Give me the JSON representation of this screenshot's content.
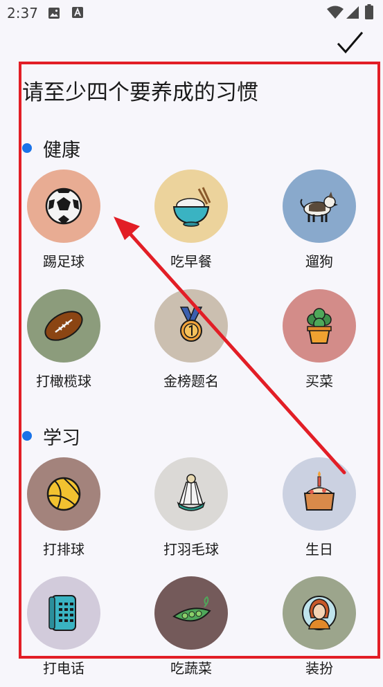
{
  "status_bar": {
    "time": "2:37",
    "icons": [
      "image-icon",
      "font-icon",
      "wifi-icon",
      "signal-icon",
      "battery-icon"
    ]
  },
  "toolbar": {
    "confirm_icon": "check-icon"
  },
  "page": {
    "title": "请至少四个要养成的习惯"
  },
  "sections": [
    {
      "label": "健康",
      "items": [
        {
          "label": "踢足球",
          "icon": "soccer-ball-icon",
          "color": "#e8ac93"
        },
        {
          "label": "吃早餐",
          "icon": "rice-bowl-icon",
          "color": "#ecd39c"
        },
        {
          "label": "遛狗",
          "icon": "dog-icon",
          "color": "#89a9cc"
        },
        {
          "label": "打橄榄球",
          "icon": "football-icon",
          "color": "#8c9c7c"
        },
        {
          "label": "金榜题名",
          "icon": "medal-icon",
          "color": "#cbbfb0"
        },
        {
          "label": "买菜",
          "icon": "potted-plant-icon",
          "color": "#d38c89"
        }
      ]
    },
    {
      "label": "学习",
      "items": [
        {
          "label": "打排球",
          "icon": "volleyball-icon",
          "color": "#a3837c"
        },
        {
          "label": "打羽毛球",
          "icon": "shuttlecock-icon",
          "color": "#dbd9d6"
        },
        {
          "label": "生日",
          "icon": "cake-icon",
          "color": "#cbd1e1"
        },
        {
          "label": "打电话",
          "icon": "telephone-icon",
          "color": "#d2cbdb"
        },
        {
          "label": "吃蔬菜",
          "icon": "peas-icon",
          "color": "#745a5a"
        },
        {
          "label": "装扮",
          "icon": "portrait-icon",
          "color": "#9ca58c"
        }
      ]
    }
  ],
  "annotation": {
    "color": "#e21e26"
  }
}
